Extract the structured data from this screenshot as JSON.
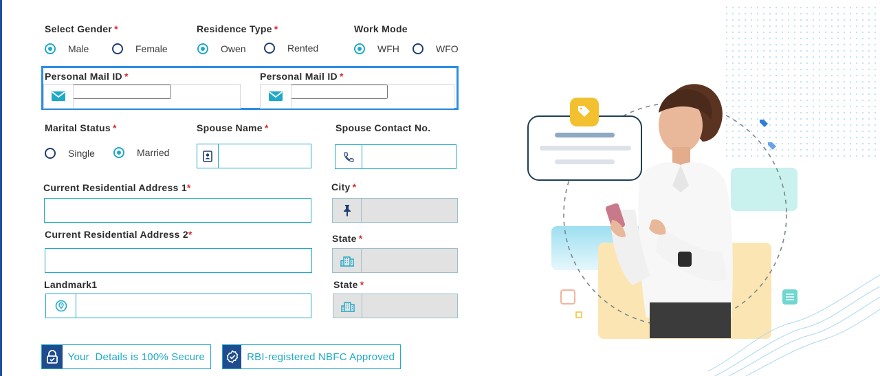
{
  "gender": {
    "label": "Select Gender",
    "options": [
      "Male",
      "Female"
    ],
    "selected": "Male"
  },
  "residence": {
    "label": "Residence Type",
    "options": [
      "Owen",
      "Rented"
    ],
    "selected": "Owen"
  },
  "workmode": {
    "label": "Work Mode",
    "options": [
      "WFH",
      "WFO"
    ],
    "selected": "WFH"
  },
  "mail": {
    "label_1": "Personal Mail ID",
    "label_2": "Personal Mail ID",
    "value_1": "",
    "value_2": ""
  },
  "marital": {
    "label": "Marital Status",
    "options": [
      "Single",
      "Married"
    ],
    "selected": "Married"
  },
  "spouse_name": {
    "label": "Spouse Name",
    "value": ""
  },
  "spouse_contact": {
    "label": "Spouse Contact No.",
    "value": ""
  },
  "address1": {
    "label": "Current Residential Address 1",
    "value": ""
  },
  "address2": {
    "label": "Current Residential Address 2",
    "value": ""
  },
  "landmark": {
    "label": "Landmark1",
    "value": ""
  },
  "city": {
    "label": "City",
    "value": ""
  },
  "state1": {
    "label": "State",
    "value": ""
  },
  "state2": {
    "label": "State",
    "value": ""
  },
  "required_mark": "*",
  "badges": {
    "secure": "Your  Details is 100% Secure",
    "rbi": "RBI-registered NBFC Approved"
  },
  "icons": [
    "mail-icon",
    "contact-book-icon",
    "phone-icon",
    "pin-icon",
    "building-icon",
    "location-icon",
    "lock-check-icon",
    "shield-check-icon",
    "tag-icon"
  ],
  "colors": {
    "accent": "#1fa9c9",
    "navy": "#1f4c8f",
    "required": "#d0302f",
    "focus": "#2b8fe3"
  }
}
